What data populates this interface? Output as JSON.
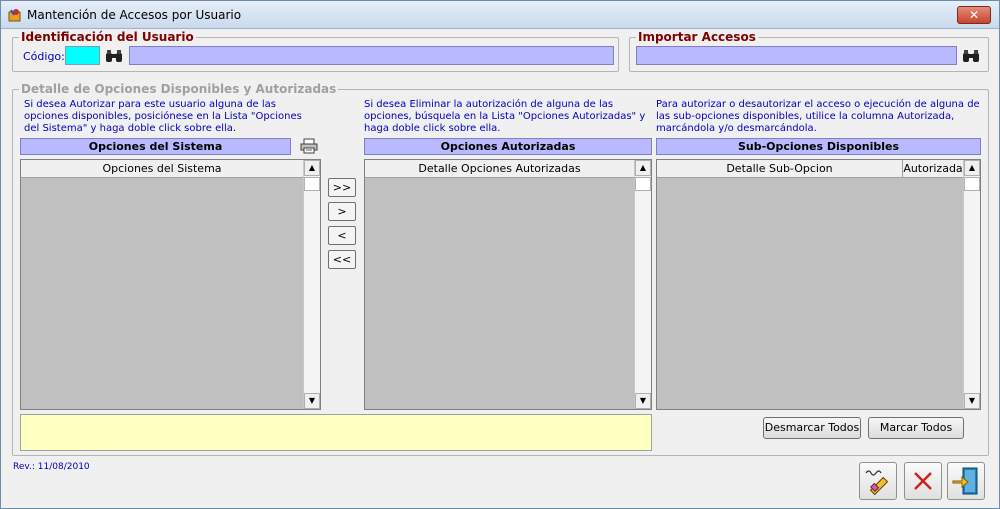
{
  "window": {
    "title": "Mantención de Accesos por Usuario",
    "close_label": "✕"
  },
  "identificacion": {
    "legend": "Identificación del Usuario",
    "codigo_label": "Código:",
    "codigo_value": "",
    "nombre_value": ""
  },
  "importar": {
    "legend": "Importar Accesos",
    "value": ""
  },
  "detalle": {
    "legend": "Detalle de Opciones Disponibles y Autorizadas"
  },
  "sistema": {
    "info": "Si desea Autorizar para este usuario alguna de las opciones disponibles, posiciónese en la Lista \"Opciones del Sistema\" y haga doble click sobre ella.",
    "header": "Opciones del Sistema",
    "column": "Opciones del Sistema"
  },
  "autorizadas": {
    "info": "Si desea Eliminar la autorización de alguna de las opciones, búsquela en la Lista \"Opciones Autorizadas\" y haga doble click sobre ella.",
    "header": "Opciones Autorizadas",
    "column": "Detalle Opciones Autorizadas"
  },
  "subopciones": {
    "info": "Para autorizar o desautorizar el acceso o ejecución de alguna de las sub-opciones disponibles, utilice la columna Autorizada, marcándola y/o desmarcándola.",
    "header": "Sub-Opciones Disponibles",
    "columns": [
      "Detalle Sub-Opcion",
      "Autorizada"
    ]
  },
  "move_buttons": {
    "add_all": ">>",
    "add_one": ">",
    "remove_one": "<",
    "remove_all": "<<"
  },
  "buttons": {
    "desmarcar": "Desmarcar Todos",
    "marcar": "Marcar Todos"
  },
  "footer": {
    "revision": "Rev.: 11/08/2010"
  },
  "colors": {
    "accent_lavender": "#b9b9ff",
    "input_cyan": "#00ffff",
    "message_yellow": "#ffffc0",
    "legend_red": "#800000",
    "info_blue": "#0000c0"
  }
}
